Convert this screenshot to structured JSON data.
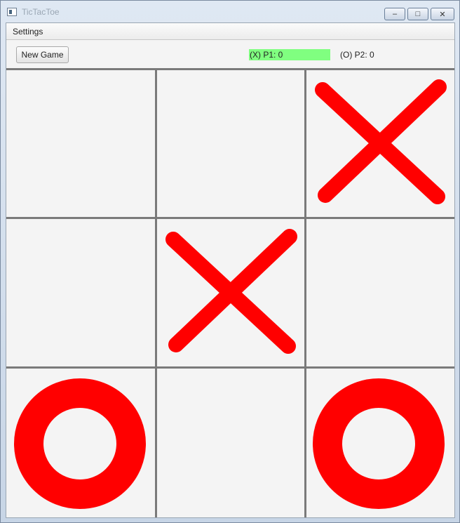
{
  "window": {
    "title": "TicTacToe",
    "controls": {
      "minimize": "–",
      "maximize": "□",
      "close": "✕"
    }
  },
  "menu": {
    "items": [
      {
        "label": "Settings"
      }
    ]
  },
  "toolbar": {
    "new_game_label": "New Game",
    "p1_label": "(X) P1: 0",
    "p2_label": "(O) P2: 0",
    "active_player_color": "#80ff80"
  },
  "board": {
    "mark_color": "#ff0000",
    "grid_color": "#7a7a7a",
    "cells": [
      {
        "row": 0,
        "col": 0,
        "mark": ""
      },
      {
        "row": 0,
        "col": 1,
        "mark": ""
      },
      {
        "row": 0,
        "col": 2,
        "mark": "X"
      },
      {
        "row": 1,
        "col": 0,
        "mark": ""
      },
      {
        "row": 1,
        "col": 1,
        "mark": "X"
      },
      {
        "row": 1,
        "col": 2,
        "mark": ""
      },
      {
        "row": 2,
        "col": 0,
        "mark": "O"
      },
      {
        "row": 2,
        "col": 1,
        "mark": ""
      },
      {
        "row": 2,
        "col": 2,
        "mark": "O"
      }
    ]
  }
}
